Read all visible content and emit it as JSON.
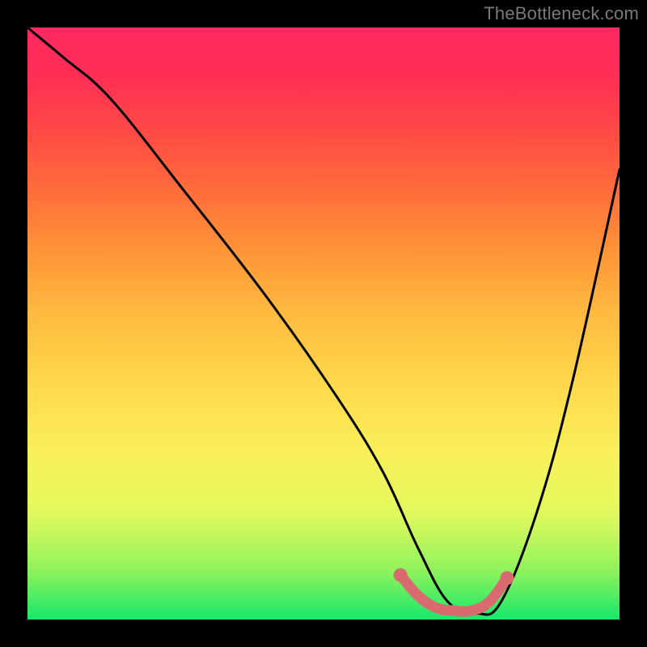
{
  "watermark": "TheBottleneck.com",
  "chart_data": {
    "type": "line",
    "title": "",
    "xlabel": "",
    "ylabel": "",
    "xlim": [
      0,
      100
    ],
    "ylim": [
      0,
      100
    ],
    "series": [
      {
        "name": "bottleneck-curve",
        "x": [
          0,
          6,
          14,
          26,
          40,
          52,
          60,
          66,
          71,
          76,
          80,
          86,
          92,
          100
        ],
        "y": [
          100,
          95,
          88,
          73,
          55,
          38,
          25,
          12,
          3,
          1,
          3,
          18,
          40,
          76
        ]
      }
    ],
    "highlight": {
      "name": "optimal-range",
      "x": [
        63,
        66,
        69,
        72,
        75,
        78,
        81
      ],
      "y": [
        7.5,
        4.0,
        2.0,
        1.5,
        1.5,
        3.0,
        7.0
      ]
    },
    "colors": {
      "curve": "#000000",
      "highlight": "#d96a6f",
      "gradient_top": "#ff2a61",
      "gradient_mid": "#ffd84c",
      "gradient_bottom": "#17e86b"
    }
  }
}
